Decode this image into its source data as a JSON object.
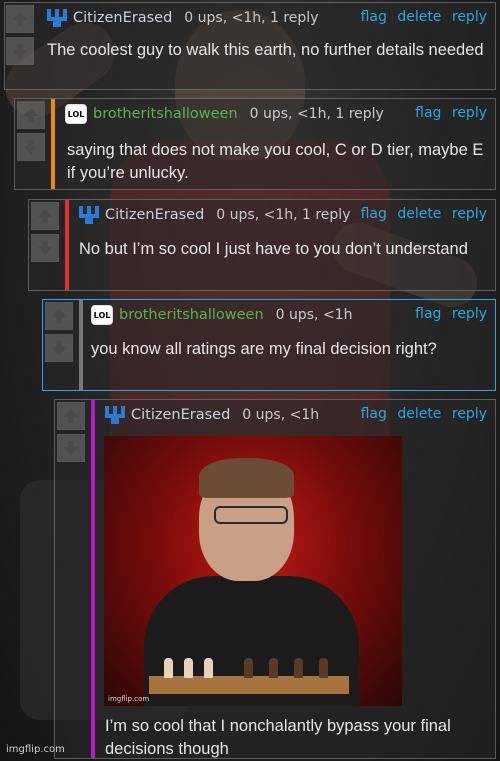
{
  "colors": {
    "link": "#2aa6e0",
    "green_user": "#59b24c",
    "stripe_orange": "#e58a1a",
    "stripe_red": "#e0302a",
    "stripe_purple": "#b51dc4"
  },
  "watermark": "imgflip.com",
  "comments": [
    {
      "user": "CitizenErased",
      "meta": "0 ups, <1h, 1 reply",
      "actions": [
        "flag",
        "delete",
        "reply"
      ],
      "text": "The coolest guy to walk this earth, no further details needed"
    },
    {
      "user": "brotheritshalloween",
      "meta": "0 ups, <1h, 1 reply",
      "actions": [
        "flag",
        "reply"
      ],
      "text": "saying that does not make you cool, C or D tier, maybe E if you’re unlucky."
    },
    {
      "user": "CitizenErased",
      "meta": "0 ups, <1h, 1 reply",
      "actions": [
        "flag",
        "delete",
        "reply"
      ],
      "text": "No but I’m so cool I just have to you don’t understand"
    },
    {
      "user": "brotheritshalloween",
      "meta": "0 ups, <1h",
      "actions": [
        "flag",
        "reply"
      ],
      "text": "you know all ratings are my final decision right?"
    },
    {
      "user": "CitizenErased",
      "meta": "0 ups, <1h",
      "actions": [
        "flag",
        "delete",
        "reply"
      ],
      "text": "I’m so cool that I nonchalantly bypass your final decisions though",
      "image_watermark": "imgflip.com"
    }
  ],
  "icons": {
    "upvote": "arrow-up-icon",
    "downvote": "arrow-down-icon",
    "avatar_blue": "pixel-avatar-icon",
    "avatar_lol": "lol-badge-icon"
  },
  "lol_label": "LOL"
}
